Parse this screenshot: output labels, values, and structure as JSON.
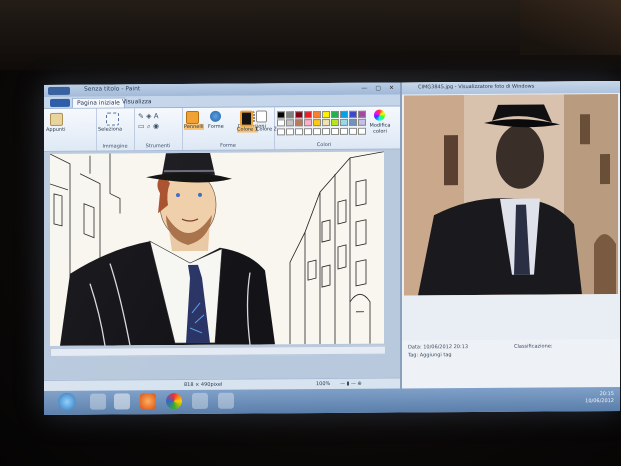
{
  "paint": {
    "title": "Senza titolo - Paint",
    "tabs": [
      "Pagina iniziale",
      "Visualizza"
    ],
    "groups": {
      "image": "Immagine",
      "tools": "Strumenti",
      "shapes": "Forme",
      "colors": "Colori"
    },
    "buttons": {
      "paste": "Appunti",
      "select": "Seleziona",
      "brushes": "Pennelli",
      "shapes": "Forme",
      "size": "Dimensioni",
      "color1": "Colore 1",
      "color2": "Colore 2",
      "edit_colors": "Modifica colori"
    },
    "palette": [
      "#000000",
      "#7f7f7f",
      "#880015",
      "#ed1c24",
      "#ff7f27",
      "#fff200",
      "#22b14c",
      "#00a2e8",
      "#3f48cc",
      "#a349a4",
      "#ffffff",
      "#c3c3c3",
      "#b97a57",
      "#ffaec9",
      "#ffc90e",
      "#efe4b0",
      "#b5e61d",
      "#99d9ea",
      "#7092be",
      "#c8bfe7",
      "#ffffff",
      "#ffffff",
      "#ffffff",
      "#ffffff",
      "#ffffff",
      "#ffffff",
      "#ffffff",
      "#ffffff",
      "#ffffff",
      "#ffffff"
    ],
    "status": {
      "size": "818 × 490pixel",
      "zoom": "100%"
    }
  },
  "viewer": {
    "title": "CIMG3845.jpg - Visualizzatore foto di Windows",
    "date": "Data: 10/06/2012 20:13",
    "rating_label": "Classificazione:",
    "tags": "Tag: Aggiungi tag"
  },
  "taskbar": {
    "time": "20:15",
    "date": "10/06/2012"
  }
}
